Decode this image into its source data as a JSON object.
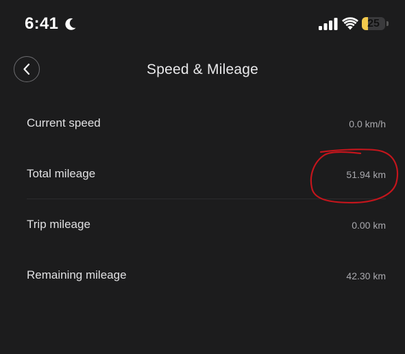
{
  "status_bar": {
    "time": "6:41",
    "battery_level": "25",
    "battery_fraction": 0.25,
    "icons": [
      "moon-icon",
      "cellular-signal-icon",
      "wifi-icon",
      "battery-icon"
    ],
    "battery_color": "#f2c94c"
  },
  "header": {
    "title": "Speed & Mileage",
    "back_icon": "chevron-left-icon"
  },
  "rows": [
    {
      "label": "Current speed",
      "value": "0.0 km/h"
    },
    {
      "label": "Total mileage",
      "value": "51.94 km"
    },
    {
      "label": "Trip mileage",
      "value": "0.00 km"
    },
    {
      "label": "Remaining mileage",
      "value": "42.30 km"
    }
  ],
  "annotation": {
    "color": "#c4151c",
    "target": "Total mileage value"
  },
  "colors": {
    "background": "#1c1c1d",
    "label": "#e0e0e2",
    "value": "#a9a9ae"
  }
}
